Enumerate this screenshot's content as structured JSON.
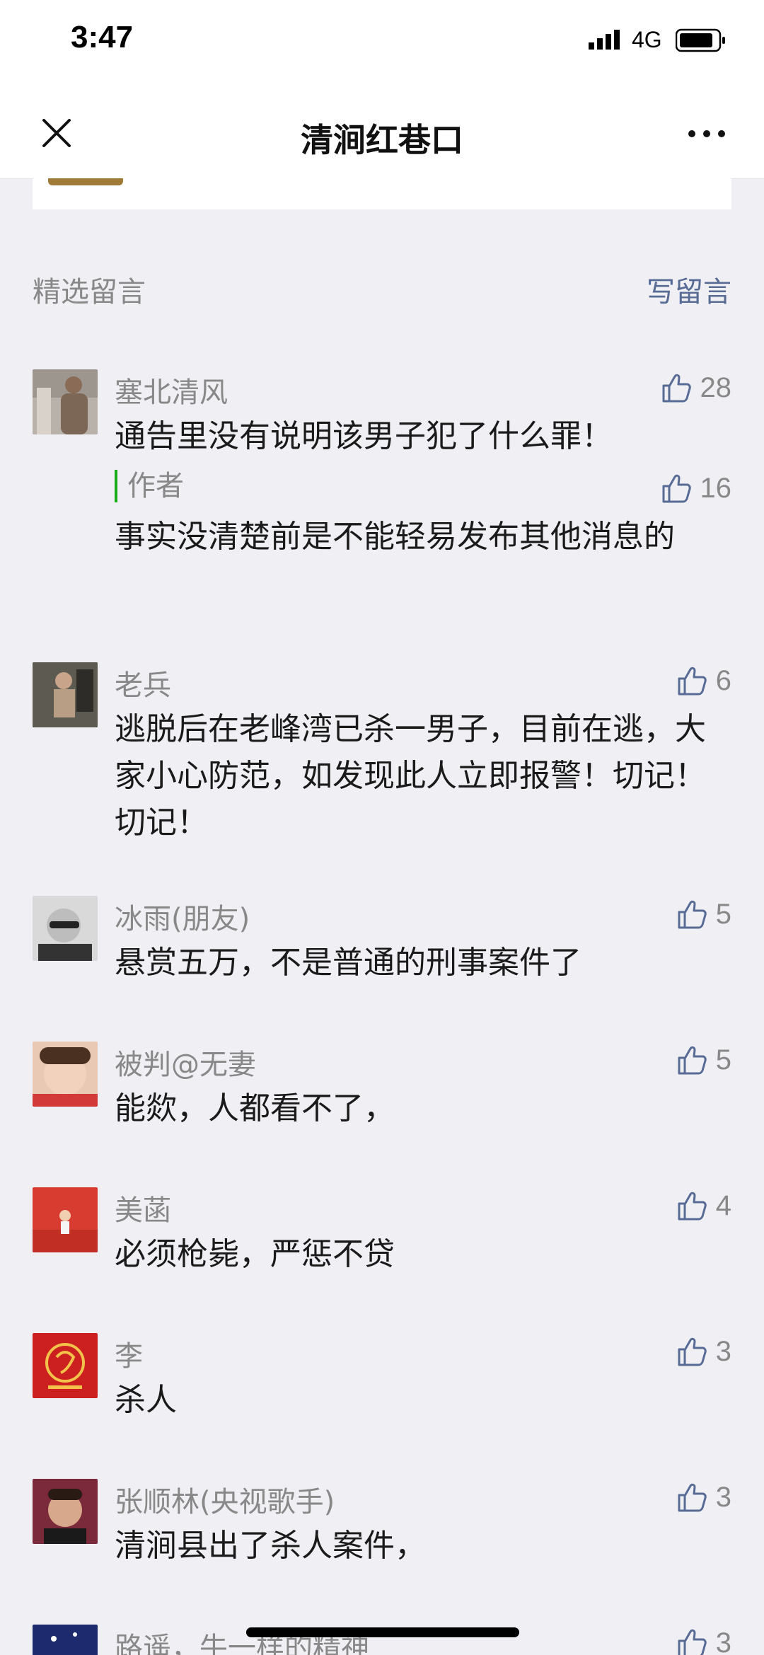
{
  "status": {
    "time": "3:47",
    "network": "4G"
  },
  "nav": {
    "title": "清涧红巷口"
  },
  "comments_header": {
    "title": "精选留言",
    "write_label": "写留言"
  },
  "comments": [
    {
      "name": "塞北清风",
      "likes": "28",
      "text": "通告里没有说明该男子犯了什么罪！",
      "reply": {
        "author": "作者",
        "likes": "16",
        "text": "事实没清楚前是不能轻易发布其他消息的"
      }
    },
    {
      "name": "老兵",
      "likes": "6",
      "text": "逃脱后在老峰湾已杀一男子，目前在逃，大家小心防范，如发现此人立即报警！切记！切记！"
    },
    {
      "name": "冰雨(朋友)",
      "likes": "5",
      "text": "悬赏五万，不是普通的刑事案件了"
    },
    {
      "name": "被判@无妻",
      "likes": "5",
      "text": "能欻，人都看不了，"
    },
    {
      "name": "美菡",
      "likes": "4",
      "text": "必须枪毙，严惩不贷"
    },
    {
      "name": "李",
      "likes": "3",
      "text": "杀人"
    },
    {
      "name": "张顺林(央视歌手)",
      "likes": "3",
      "text": "清涧县出了杀人案件，"
    },
    {
      "name": "路遥，牛一样的精神",
      "likes": "3",
      "text": ""
    }
  ]
}
